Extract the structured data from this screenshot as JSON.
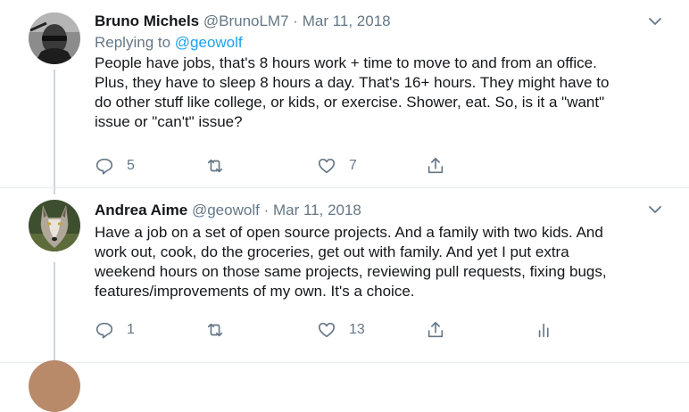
{
  "tweets": [
    {
      "display_name": "Bruno Michels",
      "handle": "@BrunoLM7",
      "separator": "·",
      "date": "Mar 11, 2018",
      "replying_prefix": "Replying to ",
      "replying_to": "@geowolf",
      "lines": [
        "People have jobs, that's 8 hours work + time to move to and from an office.",
        "Plus, they have to sleep 8 hours a day. That's 16+ hours. They might have to",
        "do other stuff like college, or kids, or exercise. Shower, eat. So, is it a \"want\"",
        "issue or \"can't\" issue?"
      ],
      "reply_count": "5",
      "retweet_count": "",
      "like_count": "7",
      "avatar_icon": "user-avatar-sunglasses"
    },
    {
      "display_name": "Andrea Aime",
      "handle": "@geowolf",
      "separator": "·",
      "date": "Mar 11, 2018",
      "lines": [
        "Have a job on a set of open source projects. And a family with two kids. And",
        "work out, cook, do the groceries, get out with family. And yet I put extra",
        "weekend hours on those same projects, reviewing pull requests, fixing bugs,",
        "features/improvements of my own. It's a choice."
      ],
      "reply_count": "1",
      "retweet_count": "",
      "like_count": "13",
      "avatar_icon": "user-avatar-wolf"
    }
  ],
  "colors": {
    "text_primary": "#14171a",
    "text_secondary": "#657786",
    "link": "#1da1f2",
    "thread_line": "#ccd6dd"
  }
}
